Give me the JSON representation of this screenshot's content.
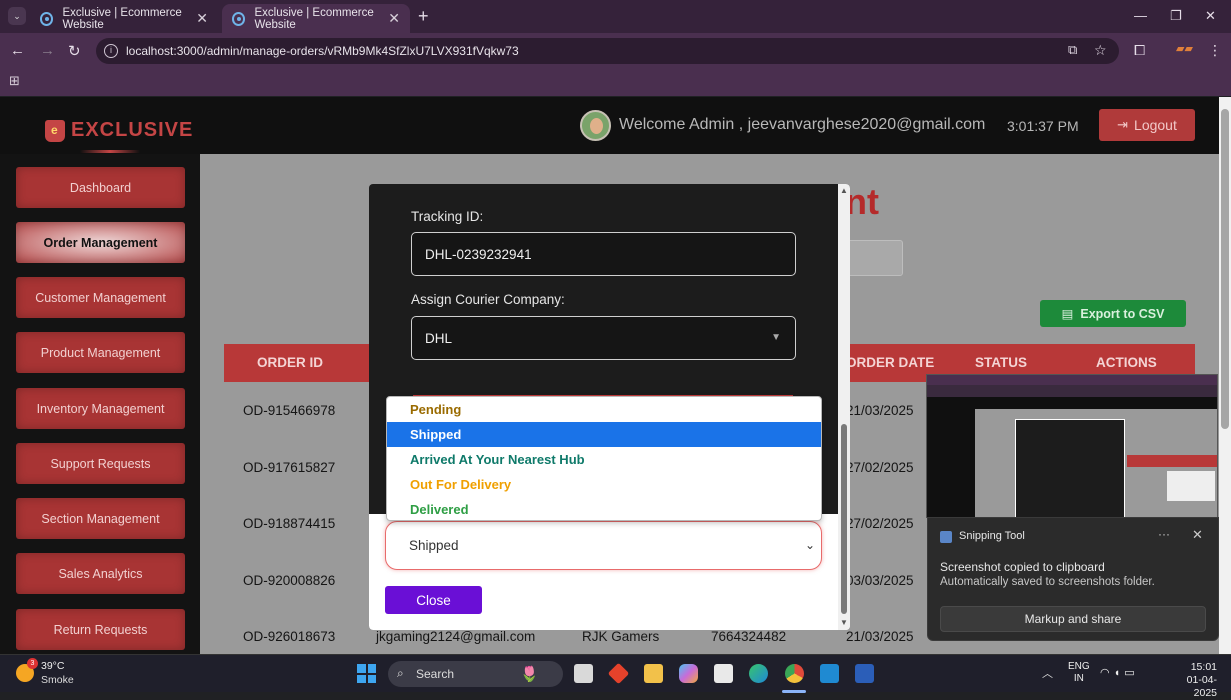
{
  "browser": {
    "tabs": [
      {
        "title": "Exclusive | Ecommerce Website"
      },
      {
        "title": "Exclusive | Ecommerce Website"
      }
    ],
    "url": "localhost:3000/admin/manage-orders/vRMb9Mk4SfZlxU7LVX931fVqkw73"
  },
  "header": {
    "logo": "EXCLUSIVE",
    "welcome": "Welcome Admin , jeevanvarghese2020@gmail.com",
    "time": "3:01:37 PM",
    "logout": "Logout"
  },
  "sidebar": {
    "items": [
      {
        "label": "Dashboard"
      },
      {
        "label": "Order Management"
      },
      {
        "label": "Customer Management"
      },
      {
        "label": "Product Management"
      },
      {
        "label": "Inventory Management"
      },
      {
        "label": "Support Requests"
      },
      {
        "label": "Section Management"
      },
      {
        "label": "Sales Analytics"
      },
      {
        "label": "Return Requests"
      }
    ]
  },
  "main": {
    "title_fragment": "nt",
    "export_label": "Export to CSV",
    "table": {
      "headers": {
        "order_id": "ORDER ID",
        "order_date": "ORDER DATE",
        "status": "STATUS",
        "actions": "ACTIONS"
      },
      "rows": [
        {
          "order_id": "OD-915466978",
          "date": "21/03/2025"
        },
        {
          "order_id": "OD-917615827",
          "date": "27/02/2025"
        },
        {
          "order_id": "OD-918874415",
          "date": "27/02/2025"
        },
        {
          "order_id": "OD-920008826",
          "date": "03/03/2025"
        },
        {
          "order_id": "OD-926018673",
          "email": "jkgaming2124@gmail.com",
          "name": "RJK Gamers",
          "phone": "7664324482",
          "date": "21/03/2025"
        }
      ]
    }
  },
  "modal": {
    "tracking_label": "Tracking ID:",
    "tracking_value": "DHL-0239232941",
    "courier_label": "Assign Courier Company:",
    "courier_value": "DHL",
    "status_value": "Shipped",
    "close_label": "Close",
    "options": [
      {
        "label": "Pending",
        "color": "#9a6b00"
      },
      {
        "label": "Shipped",
        "color": "#ffffff",
        "selected": true
      },
      {
        "label": "Arrived At Your Nearest Hub",
        "color": "#0f7a6a"
      },
      {
        "label": "Out For Delivery",
        "color": "#f0a000"
      },
      {
        "label": "Delivered",
        "color": "#2e9e44"
      }
    ]
  },
  "toast": {
    "app": "Snipping Tool",
    "title": "Screenshot copied to clipboard",
    "subtitle": "Automatically saved to screenshots folder.",
    "button": "Markup and share",
    "more": "···"
  },
  "taskbar": {
    "weather_temp": "39°C",
    "weather_desc": "Smoke",
    "weather_badge": "3",
    "search": "Search",
    "lang_1": "ENG",
    "lang_2": "IN",
    "time": "15:01",
    "date": "01-04-2025"
  }
}
